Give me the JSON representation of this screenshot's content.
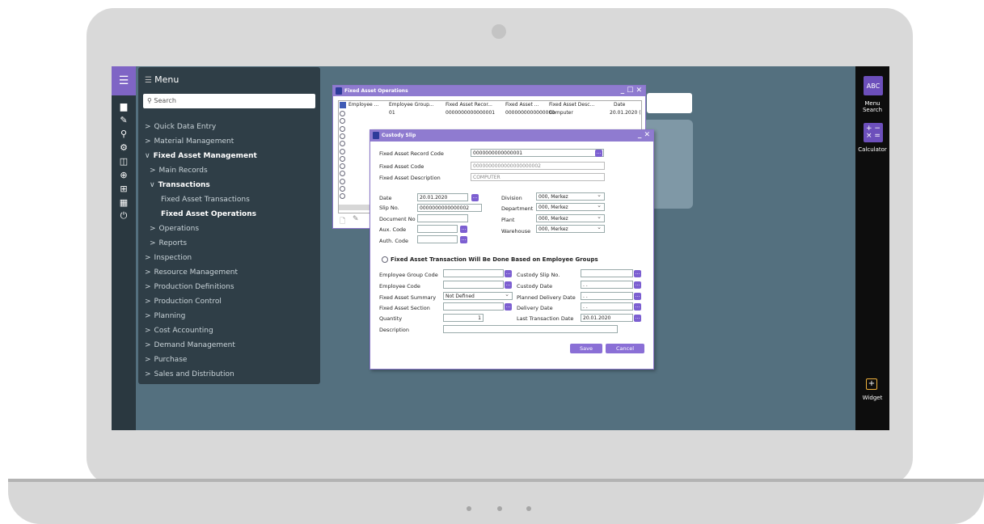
{
  "menu": {
    "title": "Menu",
    "search_placeholder": "Search",
    "items": [
      {
        "label": "Quick Data Entry",
        "prefix": ">"
      },
      {
        "label": "Material Management",
        "prefix": ">"
      },
      {
        "label": "Fixed Asset Management",
        "prefix": "∨"
      },
      {
        "label": "Main Records",
        "prefix": ">"
      },
      {
        "label": "Transactions",
        "prefix": "∨"
      },
      {
        "label": "Fixed Asset Transactions",
        "prefix": ""
      },
      {
        "label": "Fixed Asset Operations",
        "prefix": ""
      },
      {
        "label": "Operations",
        "prefix": ">"
      },
      {
        "label": "Reports",
        "prefix": ">"
      },
      {
        "label": "Inspection",
        "prefix": ">"
      },
      {
        "label": "Resource Management",
        "prefix": ">"
      },
      {
        "label": "Production Definitions",
        "prefix": ">"
      },
      {
        "label": "Production Control",
        "prefix": ">"
      },
      {
        "label": "Planning",
        "prefix": ">"
      },
      {
        "label": "Cost Accounting",
        "prefix": ">"
      },
      {
        "label": "Demand Management",
        "prefix": ">"
      },
      {
        "label": "Purchase",
        "prefix": ">"
      },
      {
        "label": "Sales and Distribution",
        "prefix": ">"
      }
    ]
  },
  "rightbar": {
    "menu_search": "Menu Search",
    "calculator": "Calculator",
    "widget": "Widget",
    "abc_icon": "ABC"
  },
  "fao": {
    "title": "Fixed Asset Operations",
    "columns": [
      "Employee ...",
      "Employee Group...",
      "Fixed Asset Recor...",
      "Fixed Asset ...",
      "Fixed Asset Desc...",
      "Date"
    ],
    "row1": {
      "employee_group": "01",
      "record": "0000000000000001",
      "fixed_asset": "0000000000000000",
      "description": "Computer",
      "date": "20.01.2020 ("
    }
  },
  "slip": {
    "title": "Custody Slip",
    "fields": {
      "record_code_label": "Fixed Asset Record Code",
      "record_code": "0000000000000001",
      "asset_code_label": "Fixed Asset Code",
      "asset_code": "0000000000000000000002",
      "asset_desc_label": "Fixed Asset Description",
      "asset_desc": "COMPUTER",
      "date_label": "Date",
      "date": "20.01.2020",
      "slip_no_label": "Slip No.",
      "slip_no": "0000000000000002",
      "document_no_label": "Document No",
      "aux_code_label": "Aux. Code",
      "auth_code_label": "Auth. Code",
      "division_label": "Division",
      "division": "000, Merkez",
      "department_label": "Department",
      "department": "000, Merkez",
      "plant_label": "Plant",
      "plant": "000, Merkez",
      "warehouse_label": "Warehouse",
      "warehouse": "000, Merkez",
      "groups_checkbox": "Fixed Asset Transaction Will Be Done Based on Employee Groups",
      "emp_group_code_label": "Employee Group Code",
      "emp_code_label": "Employee Code",
      "summary_label": "Fixed Asset Summary",
      "summary": "Not Defined",
      "section_label": "Fixed Asset Section",
      "quantity_label": "Quantity",
      "quantity": "1",
      "description_label": "Description",
      "custody_slip_no_label": "Custody Slip No.",
      "custody_date_label": "Custody Date",
      "custody_date": ". .",
      "planned_delivery_label": "Planned Delivery Date",
      "planned_delivery": ". .",
      "delivery_date_label": "Delivery Date",
      "delivery_date": ". .",
      "last_tx_label": "Last Transaction Date",
      "last_tx": "20.01.2020"
    },
    "save": "Save",
    "cancel": "Cancel"
  }
}
